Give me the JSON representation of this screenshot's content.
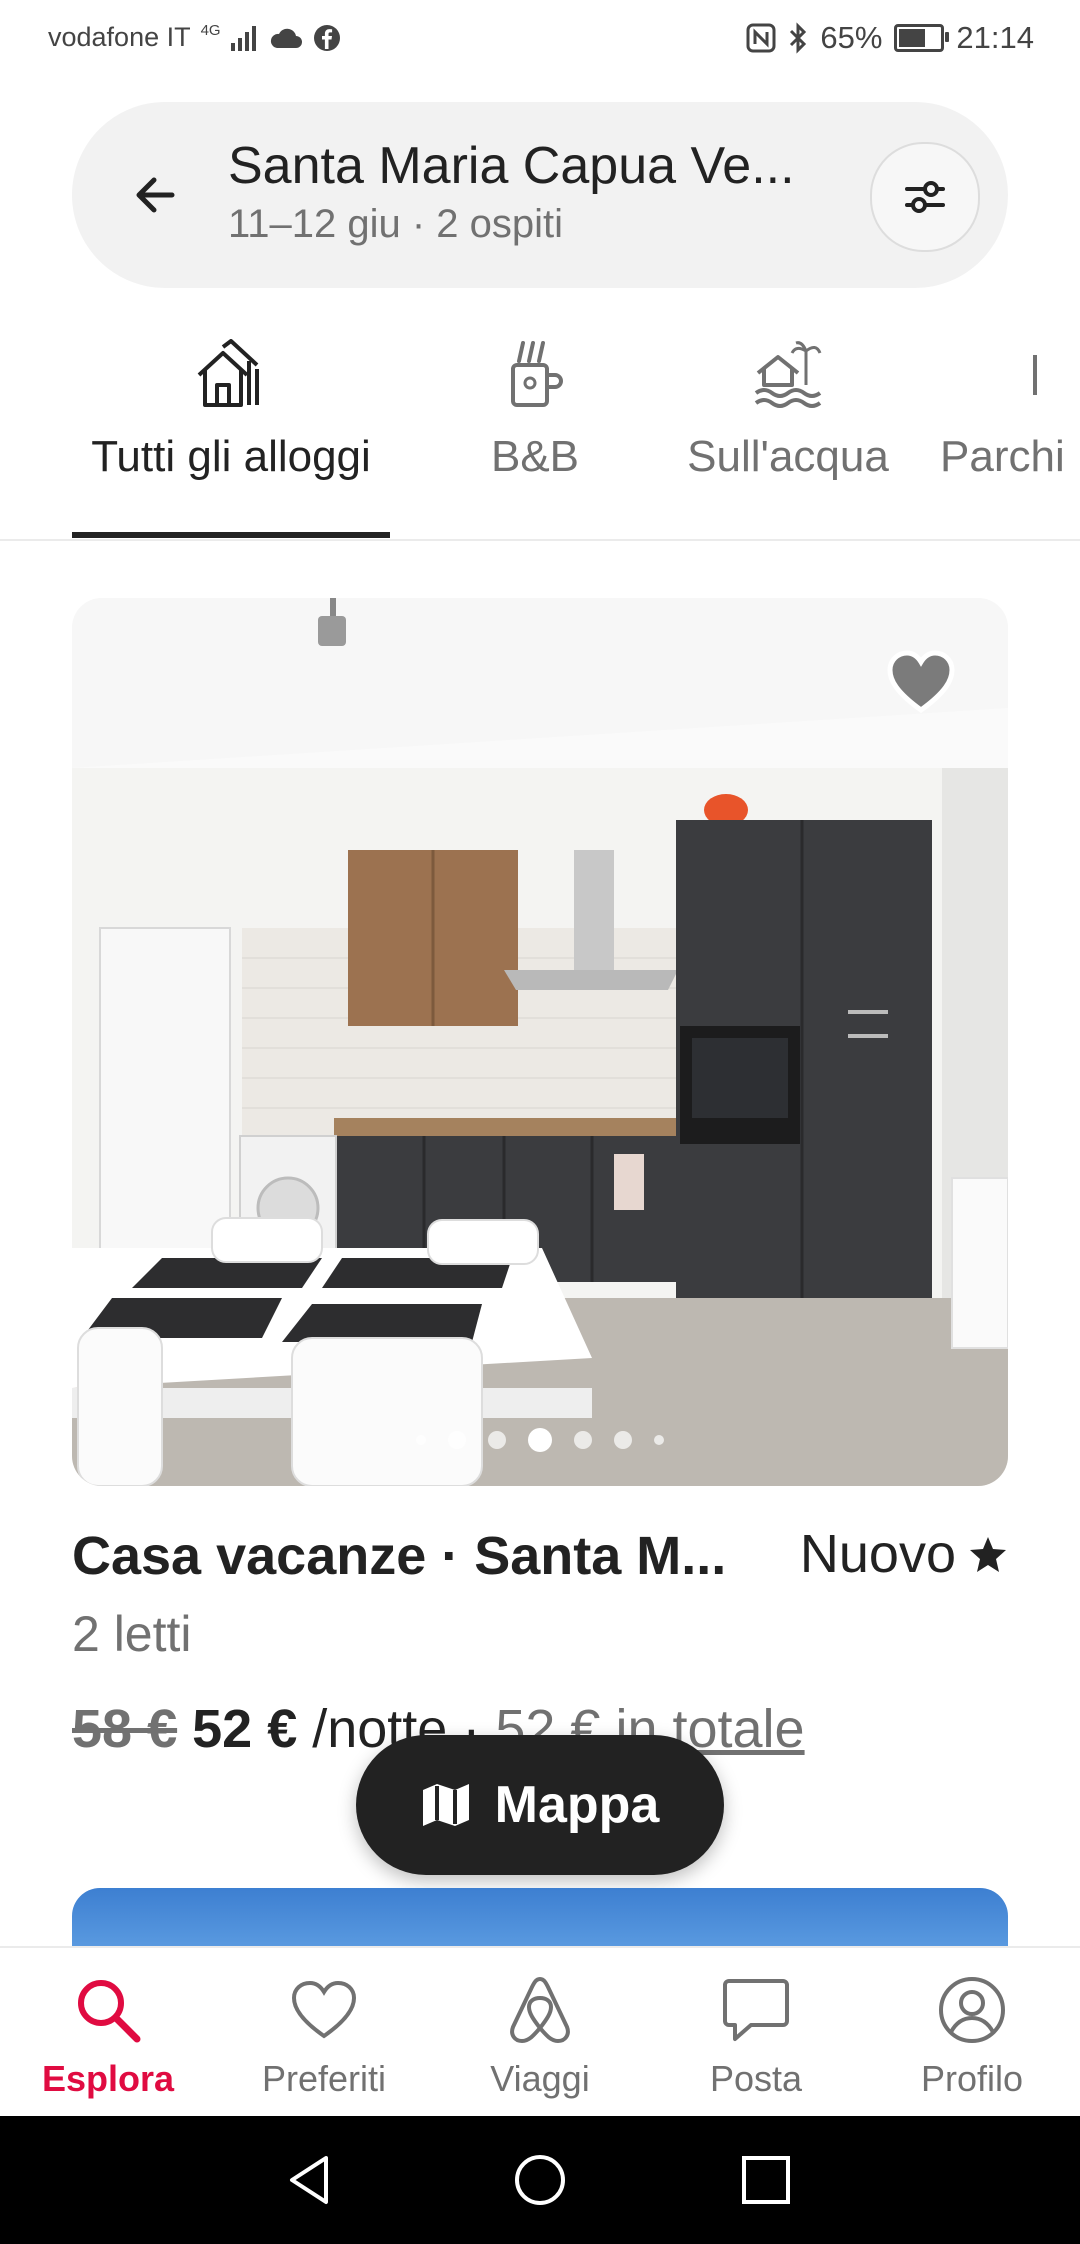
{
  "status_bar": {
    "carrier": "vodafone IT",
    "network": "4G",
    "battery_percent": "65%",
    "battery_level": 0.65,
    "time": "21:14"
  },
  "search": {
    "title": "Santa Maria Capua Ve...",
    "subtitle": "11–12 giu · 2 ospiti"
  },
  "tabs": [
    {
      "label": "Tutti gli alloggi",
      "icon": "houses-icon",
      "active": true
    },
    {
      "label": "B&B",
      "icon": "coffee-mug-icon",
      "active": false
    },
    {
      "label": "Sull'acqua",
      "icon": "beach-house-icon",
      "active": false
    },
    {
      "label": "Parchi",
      "icon": "park-icon",
      "active": false
    }
  ],
  "listing": {
    "title": "Casa vacanze · Santa M...",
    "rating_label": "Nuovo",
    "beds": "2 letti",
    "old_price": "58 €",
    "price": "52 €",
    "per": " /notte · ",
    "total": "52 € in totale",
    "photo_count": 7,
    "active_photo": 3
  },
  "map_button": {
    "label": "Mappa"
  },
  "bottom_nav": [
    {
      "label": "Esplora",
      "icon": "search-icon",
      "active": true
    },
    {
      "label": "Preferiti",
      "icon": "heart-icon",
      "active": false
    },
    {
      "label": "Viaggi",
      "icon": "airbnb-logo-icon",
      "active": false
    },
    {
      "label": "Posta",
      "icon": "chat-bubble-icon",
      "active": false
    },
    {
      "label": "Profilo",
      "icon": "profile-icon",
      "active": false
    }
  ],
  "colors": {
    "accent": "#e00b41",
    "text": "#222222",
    "muted": "#717171"
  }
}
